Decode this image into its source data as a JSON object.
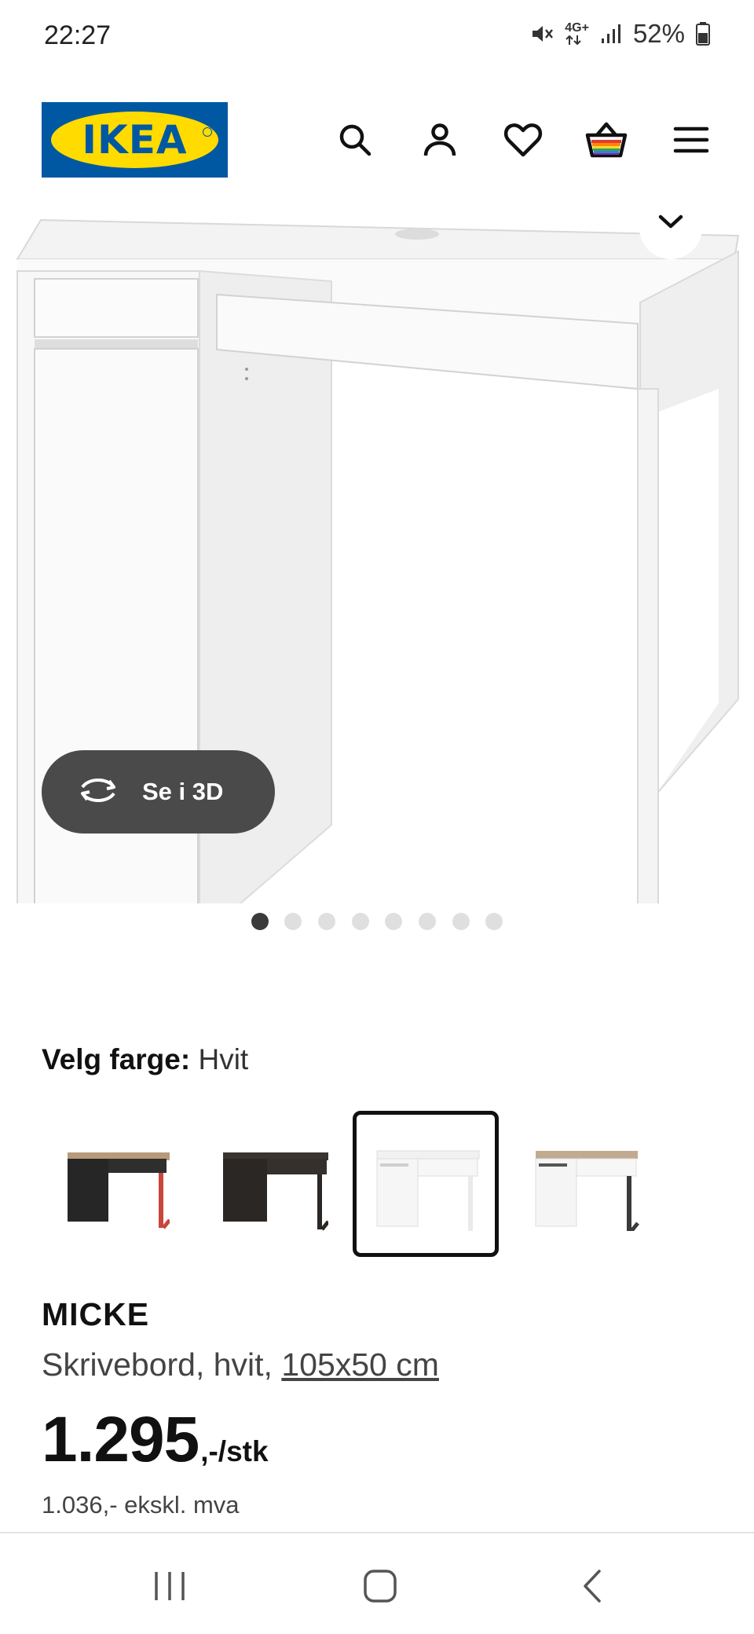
{
  "status_bar": {
    "time": "22:27",
    "battery": "52%",
    "network": "4G+",
    "icons": [
      "mute-icon",
      "network-4g-icon",
      "signal-icon",
      "battery-icon"
    ]
  },
  "header": {
    "logo_text": "IKEA",
    "icons": [
      "search-icon",
      "account-icon",
      "heart-icon",
      "cart-icon",
      "menu-icon"
    ]
  },
  "gallery": {
    "view_3d_label": "Se i 3D",
    "image_count": 8,
    "active_index": 0
  },
  "color_picker": {
    "label": "Velg farge:",
    "selected_value": "Hvit",
    "options": [
      {
        "name": "black-brown-red",
        "top": "#2a2a2a",
        "legs": "#c8473a",
        "selected": false
      },
      {
        "name": "black-brown",
        "top": "#2b2724",
        "legs": "#2b2724",
        "selected": false
      },
      {
        "name": "white",
        "top": "#f4f4f4",
        "legs": "#ececec",
        "selected": true
      },
      {
        "name": "white-anthracite",
        "top": "#f4f4f4",
        "legs": "#3a3a3a",
        "selected": false
      }
    ]
  },
  "product": {
    "name": "MICKE",
    "description": "Skrivebord, hvit, ",
    "dimensions": "105x50 cm",
    "price_main": "1.295",
    "price_suffix": ",-/stk",
    "price_ex_vat": "1.036,- ekskl. mva"
  },
  "colors": {
    "ikea_blue": "#0058a3",
    "ikea_yellow": "#ffdb00",
    "button_dark": "#4a4a4a"
  },
  "nav_bar": {
    "icons": [
      "recents-icon",
      "home-icon",
      "back-icon"
    ]
  }
}
